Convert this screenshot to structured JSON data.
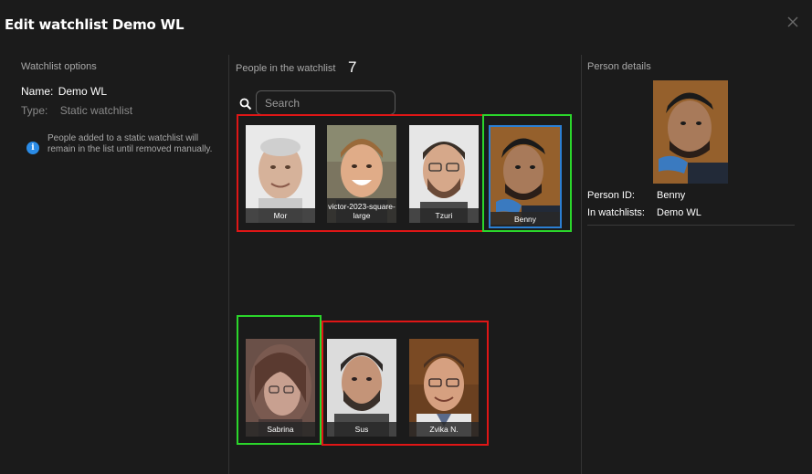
{
  "dialog": {
    "title": "Edit watchlist Demo WL"
  },
  "left": {
    "section_title": "Watchlist options",
    "name_label": "Name:",
    "name_value": "Demo WL",
    "type_label": "Type:",
    "type_value": "Static watchlist",
    "info_icon": "info-icon",
    "info_text": "People added to a static watchlist will remain in the list until removed manually."
  },
  "middle": {
    "section_title": "People in the watchlist",
    "count": "7",
    "search": {
      "placeholder": "Search",
      "value": ""
    },
    "people": [
      {
        "name": "Mor"
      },
      {
        "name": "victor-2023-square-large"
      },
      {
        "name": "Tzuri"
      },
      {
        "name": "Benny",
        "selected": true
      },
      {
        "name": "Sabrina"
      },
      {
        "name": "Sus"
      },
      {
        "name": "Zvika N."
      }
    ]
  },
  "right": {
    "section_title": "Person details",
    "person_id_label": "Person ID:",
    "person_id_value": "Benny",
    "watchlists_label": "In watchlists:",
    "watchlists_value": "Demo WL"
  },
  "colors": {
    "background": "#1b1b1b",
    "accent_blue": "#2b7fd3",
    "info_blue": "#2a8be6",
    "annotation_red": "#e01616",
    "annotation_green": "#2bd62b"
  }
}
